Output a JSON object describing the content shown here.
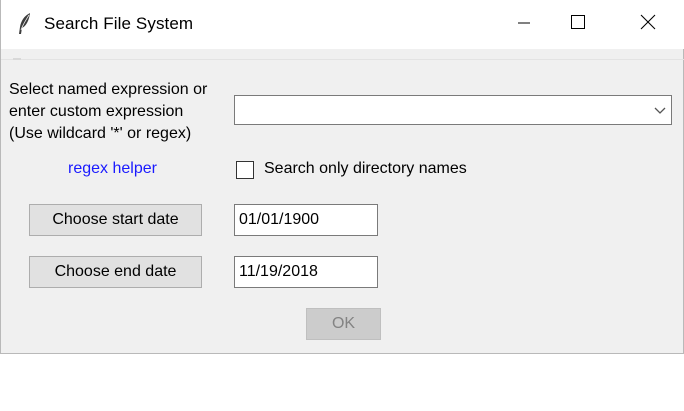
{
  "window": {
    "title": "Search File System",
    "icon": "feather-icon",
    "controls": {
      "minimize_icon": "minimize-icon",
      "maximize_icon": "maximize-icon",
      "close_icon": "close-icon"
    }
  },
  "expression": {
    "label_lines": [
      "Select named expression or",
      "enter custom expression",
      "(Use wildcard '*' or regex)"
    ],
    "value": "",
    "dropdown_icon": "chevron-down-icon"
  },
  "regex_helper": {
    "label": "regex helper",
    "color": "#1a1aff"
  },
  "directory_only": {
    "label": "Search only directory names",
    "checked": false
  },
  "start_date": {
    "button_label": "Choose start date",
    "value": "01/01/1900"
  },
  "end_date": {
    "button_label": "Choose end date",
    "value": "11/19/2018"
  },
  "ok_button": {
    "label": "OK",
    "enabled": false
  }
}
